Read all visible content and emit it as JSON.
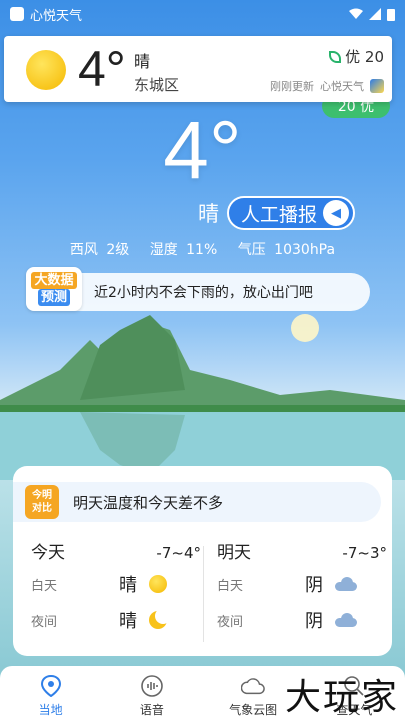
{
  "status_bar": {
    "app_name": "心悦天气"
  },
  "notification": {
    "temp": "4°",
    "condition": "晴",
    "district": "东城区",
    "aqi": "优 20",
    "updated": "刚刚更新",
    "app_name": "心悦天气"
  },
  "aqi_pill": "20 优",
  "current": {
    "temp": "4°",
    "condition": "晴",
    "broadcast_label": "人工播报",
    "wind": "西风 2级",
    "humidity": "湿度 11%",
    "pressure": "气压 1030hPa"
  },
  "prediction": {
    "badge_line1": "大数据",
    "badge_line2": "预测",
    "text": "近2小时内不会下雨的，放心出门吧"
  },
  "compare": {
    "badge_line1": "今明",
    "badge_line2": "对比",
    "headline": "明天温度和今天差不多",
    "today": {
      "name": "今天",
      "range": "-7~4°",
      "day_label": "白天",
      "day_cond": "晴",
      "day_icon": "sun-icon",
      "night_label": "夜间",
      "night_cond": "晴",
      "night_icon": "moon-icon"
    },
    "tomorrow": {
      "name": "明天",
      "range": "-7~3°",
      "day_label": "白天",
      "day_cond": "阴",
      "day_icon": "cloud-icon",
      "night_label": "夜间",
      "night_cond": "阴",
      "night_icon": "cloud-icon"
    }
  },
  "bottom_nav": [
    {
      "label": "当地",
      "icon": "location-pin-icon",
      "active": true
    },
    {
      "label": "语音",
      "icon": "voice-icon",
      "active": false
    },
    {
      "label": "气象云图",
      "icon": "cloud-map-icon",
      "active": false
    },
    {
      "label": "查天气",
      "icon": "search-weather-icon",
      "active": false
    }
  ],
  "watermark": "大玩家",
  "colors": {
    "accent": "#2f7fe8",
    "aqi_green": "#3dbf6e",
    "badge_orange": "#f5a623"
  }
}
